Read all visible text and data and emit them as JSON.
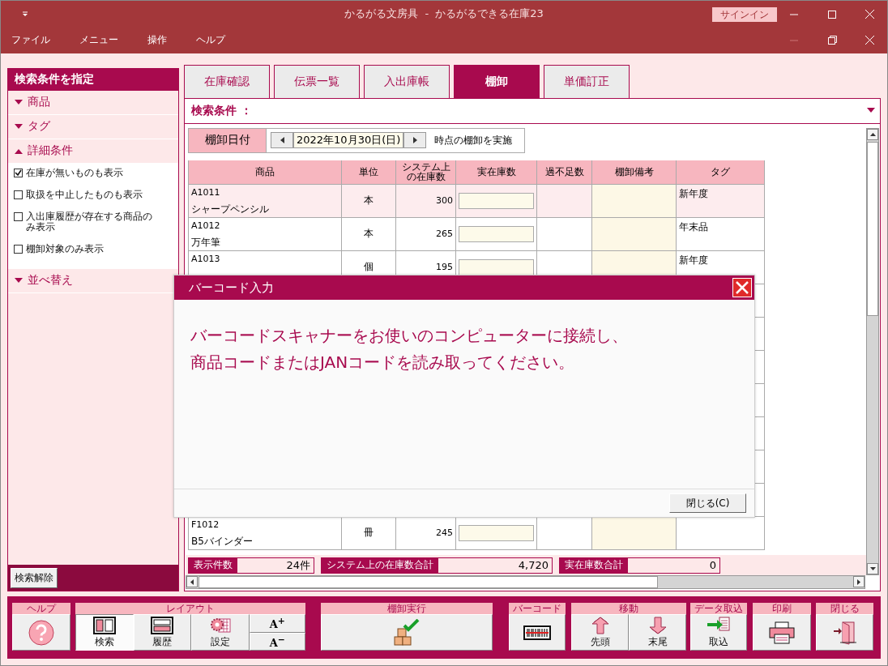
{
  "window": {
    "title": "かるがる文房具  -  かるがるできる在庫23",
    "signin": "サインイン"
  },
  "menu": [
    "ファイル",
    "メニュー",
    "操作",
    "ヘルプ"
  ],
  "sidebar": {
    "title": "検索条件を指定",
    "sections": [
      {
        "label": "商品",
        "expanded": false
      },
      {
        "label": "タグ",
        "expanded": false
      },
      {
        "label": "詳細条件",
        "expanded": true,
        "options": [
          {
            "label": "在庫が無いものも表示",
            "checked": true
          },
          {
            "label": "取扱を中止したものも表示",
            "checked": false
          },
          {
            "label": "入出庫履歴が存在する商品のみ表示",
            "checked": false
          },
          {
            "label": "棚卸対象のみ表示",
            "checked": false
          }
        ]
      },
      {
        "label": "並べ替え",
        "expanded": false
      }
    ],
    "clear_button": "検索解除"
  },
  "tabs": [
    {
      "label": "在庫確認",
      "selected": false
    },
    {
      "label": "伝票一覧",
      "selected": false
    },
    {
      "label": "入出庫帳",
      "selected": false
    },
    {
      "label": "棚卸",
      "selected": true
    },
    {
      "label": "単価訂正",
      "selected": false
    }
  ],
  "search_header": "検索条件 ：",
  "date_bar": {
    "label": "棚卸日付",
    "date": "2022年10月30日(日)",
    "suffix": "時点の棚卸を実施"
  },
  "table": {
    "columns": [
      "商品",
      "単位",
      "システム上の在庫数",
      "実在庫数",
      "過不足数",
      "棚卸備考",
      "タグ"
    ],
    "rows": [
      {
        "code": "A1011",
        "name": "シャープペンシル",
        "unit": "本",
        "system_stock": "300",
        "tag": "新年度",
        "selected": true
      },
      {
        "code": "A1012",
        "name": "万年筆",
        "unit": "本",
        "system_stock": "265",
        "tag": "年末品",
        "selected": false
      },
      {
        "code": "A1013",
        "unit": "個",
        "system_stock": "195",
        "tag": "新年度",
        "selected": false
      },
      {
        "code": "F1012",
        "name": "B5バインダー",
        "unit": "冊",
        "system_stock": "245",
        "selected": false
      }
    ]
  },
  "summary": [
    {
      "label": "表示件数",
      "value": "24件"
    },
    {
      "label": "システム上の在庫数合計",
      "value": "4,720"
    },
    {
      "label": "実在庫数合計",
      "value": "0"
    }
  ],
  "dialog": {
    "title": "バーコード入力",
    "message_lines": [
      "バーコードスキャナーをお使いのコンピューターに接続し、",
      "商品コードまたはJANコードを読み取ってください。"
    ],
    "close_button": "閉じる(C)"
  },
  "toolbar": [
    {
      "title": "ヘルプ",
      "buttons": [
        {
          "kind": "help"
        }
      ]
    },
    {
      "title": "レイアウト",
      "buttons": [
        {
          "kind": "layout-search",
          "label": "検索",
          "selected": true
        },
        {
          "kind": "layout-history",
          "label": "履歴",
          "selected": false
        },
        {
          "kind": "settings",
          "label": "設定",
          "selected": false
        },
        {
          "kind": "font-size",
          "labels": [
            "A$^{+}$",
            "A$^{−}$"
          ]
        }
      ]
    },
    {
      "title": "棚卸実行",
      "buttons": [
        {
          "kind": "boxes"
        }
      ]
    },
    {
      "title": "バーコード",
      "buttons": [
        {
          "kind": "barcode"
        }
      ]
    },
    {
      "title": "移動",
      "buttons": [
        {
          "kind": "up",
          "label": "先頭"
        },
        {
          "kind": "down",
          "label": "末尾"
        }
      ]
    },
    {
      "title": "データ取込",
      "buttons": [
        {
          "kind": "import",
          "label": "取込"
        }
      ]
    },
    {
      "title": "印刷",
      "buttons": [
        {
          "kind": "print"
        }
      ]
    },
    {
      "title": "閉じる",
      "buttons": [
        {
          "kind": "exit"
        }
      ]
    }
  ]
}
